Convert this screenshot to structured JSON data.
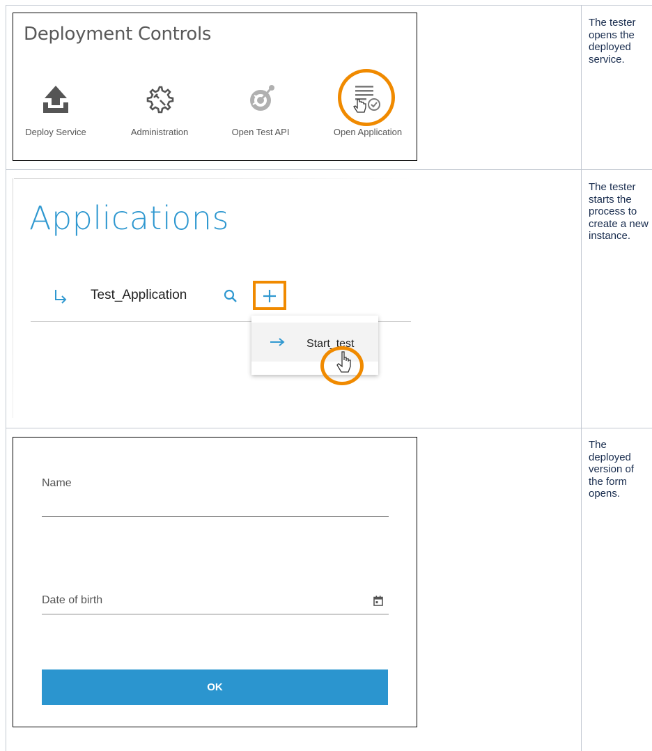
{
  "rows": [
    {
      "panel": {
        "title": "Deployment Controls",
        "controls": [
          {
            "label": "Deploy Service",
            "icon": "upload-icon"
          },
          {
            "label": "Administration",
            "icon": "gear-wrench-icon"
          },
          {
            "label": "Open Test API",
            "icon": "api-icon"
          },
          {
            "label": "Open Application",
            "icon": "application-icon"
          }
        ]
      },
      "description": "The tester opens the deployed service."
    },
    {
      "panel": {
        "title": "Applications",
        "app_name": "Test_Application",
        "menu_item": "Start_test"
      },
      "description": "The tester starts the process to create a new instance."
    },
    {
      "panel": {
        "fields": [
          {
            "label": "Name"
          },
          {
            "label": "Date of birth"
          }
        ],
        "ok_label": "OK"
      },
      "description": "The deployed version of the form opens."
    }
  ],
  "colors": {
    "highlight": "#f08a00",
    "accent": "#2b95cf",
    "grid": "#c1c7d0"
  }
}
